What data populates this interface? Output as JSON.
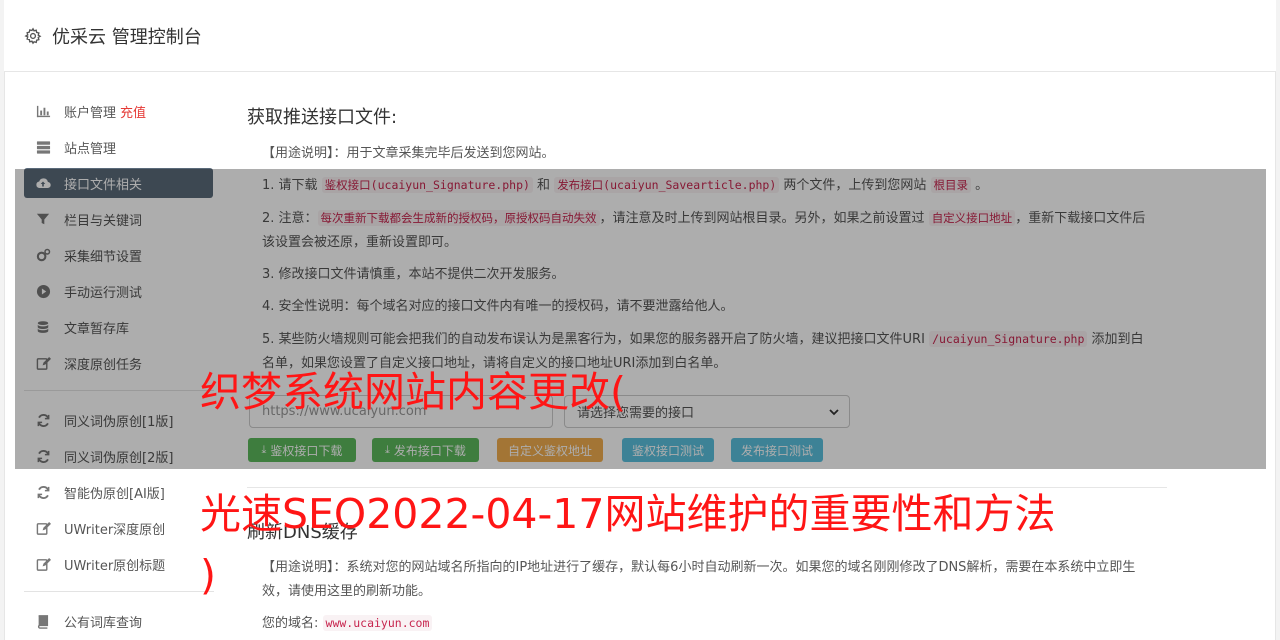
{
  "header": {
    "title": "优采云 管理控制台",
    "icon": "gear-icon"
  },
  "sidebar": {
    "items": [
      {
        "label": "账户管理",
        "badge": "充值",
        "icon": "bar-chart-icon"
      },
      {
        "label": "站点管理",
        "icon": "server-icon"
      },
      {
        "label": "接口文件相关",
        "icon": "cloud-upload-icon",
        "active": true
      },
      {
        "label": "栏目与关键词",
        "icon": "filter-icon"
      },
      {
        "label": "采集细节设置",
        "icon": "cogs-icon"
      },
      {
        "label": "手动运行测试",
        "icon": "play-circle-icon"
      },
      {
        "label": "文章暂存库",
        "icon": "database-icon"
      },
      {
        "label": "深度原创任务",
        "icon": "edit-icon"
      },
      {
        "label": "同义词伪原创[1版]",
        "icon": "refresh-icon"
      },
      {
        "label": "同义词伪原创[2版]",
        "icon": "refresh-icon"
      },
      {
        "label": "智能伪原创[AI版]",
        "icon": "refresh-icon"
      },
      {
        "label": "UWriter深度原创",
        "icon": "edit-icon"
      },
      {
        "label": "UWriter原创标题",
        "icon": "edit-icon"
      },
      {
        "label": "公有词库查询",
        "icon": "book-icon"
      }
    ]
  },
  "main": {
    "section1": {
      "title": "获取推送接口文件:",
      "usage": "【用途说明】：用于文章采集完毕后发送到您网站。",
      "p1": {
        "t1": "1. 请下载 ",
        "c1": "鉴权接口(ucaiyun_Signature.php)",
        "t2": " 和 ",
        "c2": "发布接口(ucaiyun_Savearticle.php)",
        "t3": " 两个文件，上传到您网站 ",
        "c3": "根目录",
        "t4": " 。"
      },
      "p2": {
        "t1": "2. 注意：",
        "c1": "每次重新下载都会生成新的授权码，原授权码自动失效",
        "t2": "，请注意及时上传到网站根目录。另外，如果之前设置过 ",
        "c2": "自定义接口地址",
        "t3": "，重新下载接口文件后该设置会被还原，重新设置即可。"
      },
      "p3": "3. 修改接口文件请慎重，本站不提供二次开发服务。",
      "p4": "4. 安全性说明：每个域名对应的接口文件内有唯一的授权码，请不要泄露给他人。",
      "p5": {
        "t1": "5. 某些防火墙规则可能会把我们的自动发布误认为是黑客行为，如果您的服务器开启了防火墙，建议把接口文件URI ",
        "c1": "/ucaiyun_Signature.php",
        "t2": " 添加到白名单，如果您设置了自定义接口地址，请将自定义的接口地址URI添加到白名单。"
      },
      "url_input": {
        "placeholder": "https://www.ucaiyun.com"
      },
      "select": {
        "value": "请选择您需要的接口"
      },
      "buttons": {
        "auth_download": "鉴权接口下载",
        "publish_download": "发布接口下载",
        "custom_auth": "自定义鉴权地址",
        "auth_test": "鉴权接口测试",
        "publish_test": "发布接口测试"
      }
    },
    "section2": {
      "title": "刷新DNS缓存",
      "usage": "【用途说明】：系统对您的网站域名所指向的IP地址进行了缓存，默认每6小时自动刷新一次。如果您的域名刚刚修改了DNS解析，需要在本系统中立即生效，请使用这里的刷新功能。",
      "domain_label": "您的域名:",
      "domain_value": "www.ucaiyun.com"
    }
  },
  "overlay_text": {
    "line1": "织梦系统网站内容更改(",
    "line2": "光速SEO2022-04-17网站维护的重要性和方法",
    "line3": ")"
  },
  "colors": {
    "active_nav": "#5a6a7a",
    "code_text": "#c7254e",
    "overlay_text": "#ff1515"
  }
}
